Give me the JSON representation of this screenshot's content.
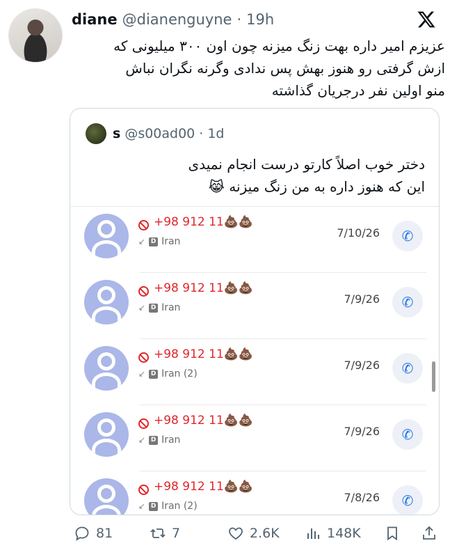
{
  "tweet": {
    "author_name": "diane",
    "author_handle": "@dianenguyne",
    "separator": "·",
    "time": "19h",
    "text_lines": [
      "عزیزم امیر داره بهت زنگ میزنه چون اون ۳۰۰ میلیونی که",
      "ازش گرفتی رو هنوز بهش پس ندادی وگرنه نگران نباش",
      "منو اولین نفر درجریان گذاشته"
    ]
  },
  "quote": {
    "author_name": "s",
    "author_handle": "@s00ad00",
    "separator": "·",
    "time": "1d",
    "text_lines": [
      "دختر خوب اصلاً کارتو درست انجام نمیدی",
      "این که هنوز داره به من زنگ میزنه 😹"
    ],
    "calls": [
      {
        "number": "+98 912 11💩💩",
        "meta": "Iran",
        "date": "7/10/26"
      },
      {
        "number": "+98 912 11💩💩",
        "meta": "Iran",
        "date": "7/9/26"
      },
      {
        "number": "+98 912 11💩💩",
        "meta": "Iran (2)",
        "date": "7/9/26"
      },
      {
        "number": "+98 912 11💩💩",
        "meta": "Iran",
        "date": "7/9/26"
      },
      {
        "number": "+98 912 11💩💩",
        "meta": "Iran (2)",
        "date": "7/8/26"
      }
    ]
  },
  "actions": {
    "replies": "81",
    "retweets": "7",
    "likes": "2.6K",
    "views": "148K"
  },
  "icons": {
    "logo": "x-logo-icon",
    "reply": "reply-icon",
    "retweet": "retweet-icon",
    "like": "heart-icon",
    "views": "views-icon",
    "bookmark": "bookmark-icon",
    "share": "share-icon"
  },
  "colors": {
    "blocked": "#e0262b",
    "call_button": "#1a73e8",
    "secondary_text": "#536471"
  }
}
